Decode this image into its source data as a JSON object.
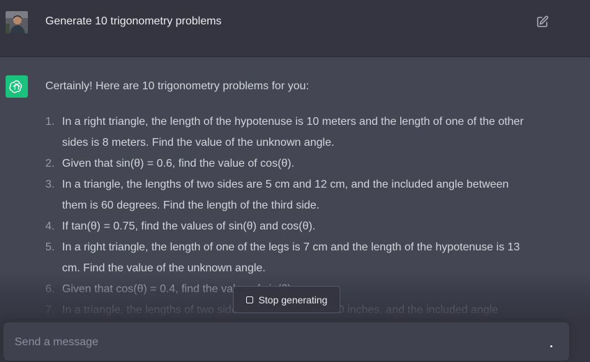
{
  "user_message": {
    "text": "Generate 10 trigonometry problems",
    "avatar_icon": "user-photo",
    "edit_icon": "edit-icon"
  },
  "assistant": {
    "avatar_icon": "openai-logo-icon",
    "avatar_color": "#19c37d",
    "intro": "Certainly! Here are 10 trigonometry problems for you:",
    "problems": [
      {
        "num": "1.",
        "text": "In a right triangle, the length of the hypotenuse is 10 meters and the length of one of the other sides is 8 meters. Find the value of the unknown angle."
      },
      {
        "num": "2.",
        "text": "Given that sin(θ) = 0.6, find the value of cos(θ)."
      },
      {
        "num": "3.",
        "text": "In a triangle, the lengths of two sides are 5 cm and 12 cm, and the included angle between them is 60 degrees. Find the length of the third side."
      },
      {
        "num": "4.",
        "text": "If tan(θ) = 0.75, find the values of sin(θ) and cos(θ)."
      },
      {
        "num": "5.",
        "text": "In a right triangle, the length of one of the legs is 7 cm and the length of the hypotenuse is 13 cm. Find the value of the unknown angle."
      },
      {
        "num": "6.",
        "text": "Given that cos(θ) = 0.4, find the value of sin(θ)."
      },
      {
        "num": "7.",
        "text": "In a triangle, the lengths of two sides are 8 inches and 10 inches, and the included angle"
      }
    ]
  },
  "stop_button": {
    "label": "Stop generating"
  },
  "composer": {
    "placeholder": "Send a message"
  },
  "colors": {
    "user_bg": "#343541",
    "assistant_bg": "#444654",
    "input_bg": "#40414f"
  }
}
